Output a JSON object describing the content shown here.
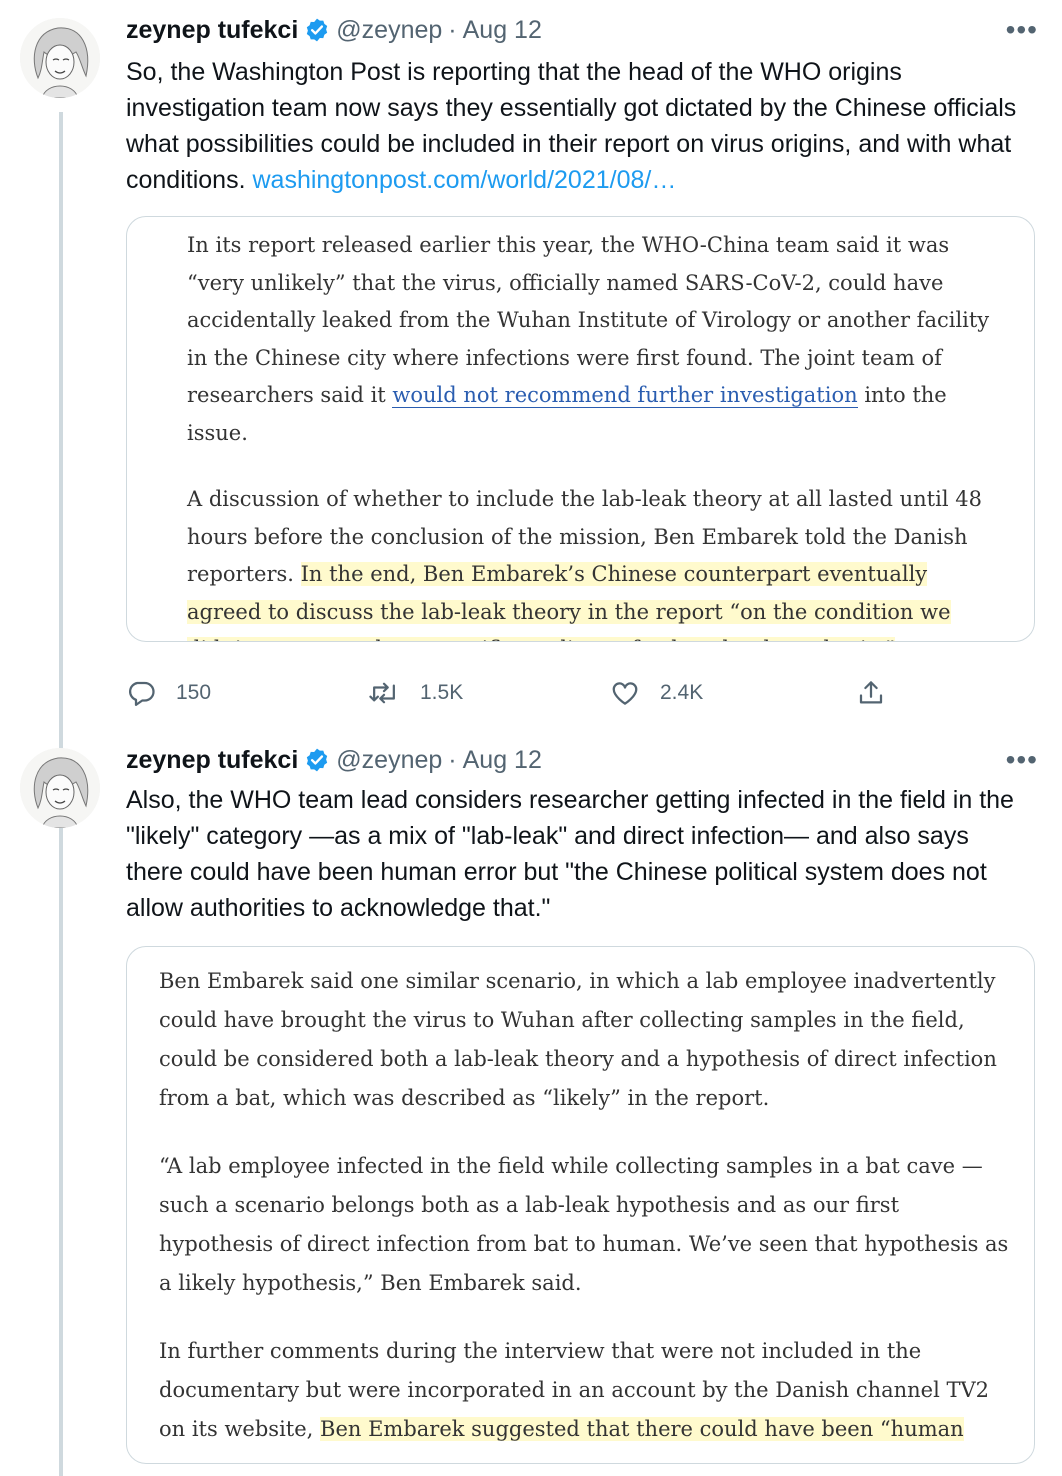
{
  "tweets": [
    {
      "author_name": "zeynep tufekci",
      "handle": "@zeynep",
      "separator": "·",
      "date": "Aug 12",
      "text": "So, the Washington Post is reporting that the head of the WHO origins investigation team now says they essentially got dictated by the Chinese officials what possibilities could be included in their report on virus origins, and with what conditions.",
      "link_text": "washingtonpost.com/world/2021/08/…",
      "card": {
        "p1_a": "In its report released earlier this year, the WHO-China team said it was “very unlikely” that the virus, officially named SARS-CoV-2, could have accidentally leaked from the Wuhan Institute of Virology or another facility in the Chinese city where infections were first found. The joint team of researchers said it ",
        "p1_link": "would not recommend further investigation",
        "p1_b": " into the issue.",
        "p2_a": "A discussion of whether to include the lab-leak theory at all lasted until 48 hours before the conclusion of the mission, Ben Embarek told the Danish reporters. ",
        "p2_highlight": "In the end, Ben Embarek’s Chinese counterpart eventually agreed to discuss the lab-leak theory in the report “on the condition we didn’t recommend any specific studies to further that hypothesis.”"
      },
      "actions": {
        "replies": "150",
        "retweets": "1.5K",
        "likes": "2.4K"
      }
    },
    {
      "author_name": "zeynep tufekci",
      "handle": "@zeynep",
      "separator": "·",
      "date": "Aug 12",
      "text": "Also, the WHO team lead considers researcher getting infected in the field in the \"likely\" category —as a mix of \"lab-leak\" and direct infection— and also says there could have been human error but \"the Chinese political system does not allow authorities to acknowledge that.\"",
      "card": {
        "p1": "Ben Embarek said one similar scenario, in which a lab employee inadvertently could have brought the virus to Wuhan after collecting samples in the field, could be considered both a lab-leak theory and a hypothesis of direct infection from a bat, which was described as “likely” in the report.",
        "p2": "“A lab employee infected in the field while collecting samples in a bat cave — such a scenario belongs both as a lab-leak hypothesis and as our first hypothesis of direct infection from bat to human. We’ve seen that hypothesis as a likely hypothesis,” Ben Embarek said.",
        "p3_a": "In further comments during the interview that were not included in the documentary but were incorporated in an account by the Danish channel TV2 on its website, ",
        "p3_highlight": "Ben Embarek suggested that there could have been “human"
      }
    }
  ],
  "icons": {
    "verified": "verified-badge-icon",
    "more": "more-icon",
    "reply": "reply-icon",
    "retweet": "retweet-icon",
    "like": "like-icon",
    "share": "share-icon"
  },
  "colors": {
    "link": "#1d9bf0",
    "highlight": "#fffacd",
    "verified": "#1d9bf0"
  }
}
